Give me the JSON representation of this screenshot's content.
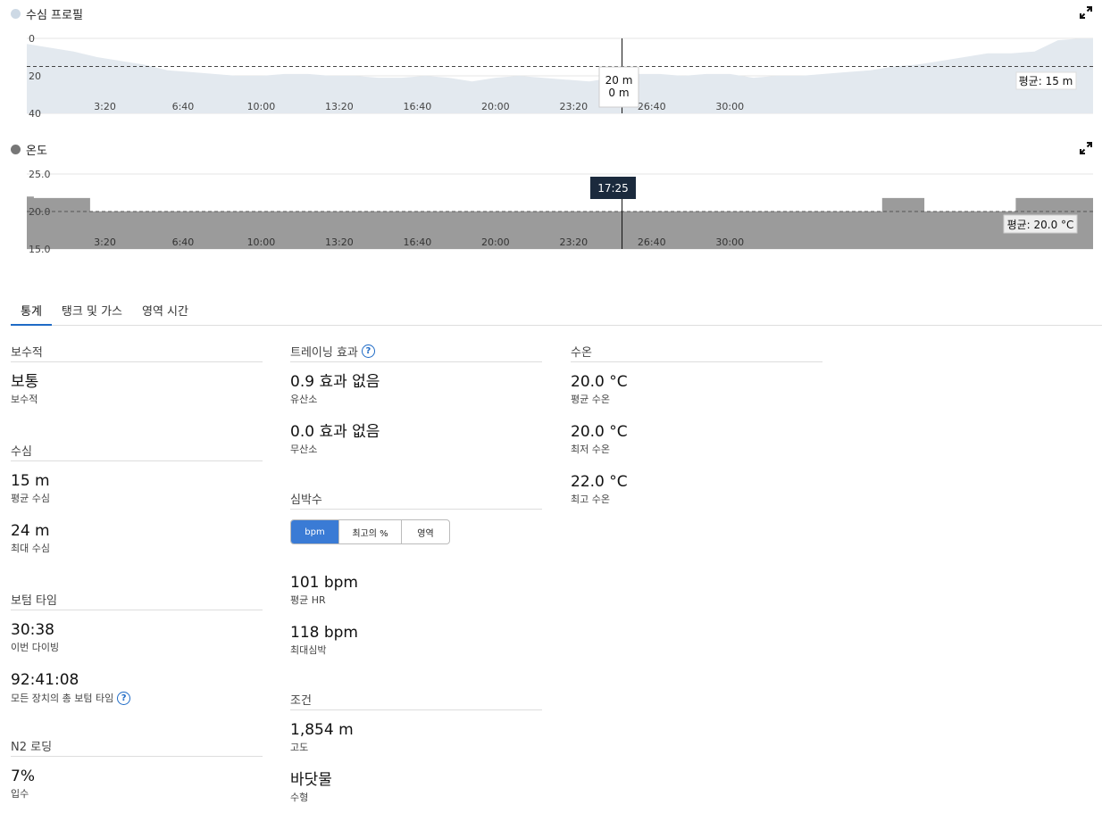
{
  "depth_chart": {
    "title": "수심 프로필",
    "dot_color": "#cdd9e5",
    "fill_color": "#e3e9ef",
    "avg_label": "평균: 15 m",
    "tooltip_line1": "20 m",
    "tooltip_line2": "0 m",
    "y_ticks": [
      "0",
      "20",
      "40"
    ]
  },
  "temp_chart": {
    "title": "온도",
    "dot_color": "#777777",
    "fill_color": "#9b9b9b",
    "avg_label": "평균: 20.0 °C",
    "cursor_time": "17:25",
    "y_ticks": [
      "25.0",
      "20.0",
      "15.0"
    ]
  },
  "x_ticks": [
    "3:20",
    "6:40",
    "10:00",
    "13:20",
    "16:40",
    "20:00",
    "23:20",
    "26:40",
    "30:00"
  ],
  "chart_data": [
    {
      "type": "area",
      "title": "수심 프로필",
      "x_unit": "min",
      "ylim": [
        0,
        40
      ],
      "y_inverted": true,
      "average": 15,
      "cursor_x": 25.4,
      "x": [
        0,
        1,
        2,
        3,
        4,
        5,
        6,
        7,
        8,
        9,
        10,
        11,
        12,
        13,
        14,
        15,
        16,
        17,
        18,
        19,
        20,
        21,
        22,
        23,
        24,
        25,
        26,
        27,
        28,
        29,
        30,
        31,
        32,
        33,
        34,
        35,
        36,
        37,
        38,
        39,
        40,
        41,
        42,
        43,
        44,
        45
      ],
      "y": [
        3,
        5,
        7,
        10,
        12,
        14,
        17,
        18,
        19,
        20,
        20,
        19,
        19,
        20,
        20,
        21,
        21,
        20,
        21,
        23,
        21,
        20,
        21,
        22,
        23,
        21,
        19,
        19,
        20,
        19,
        19,
        21,
        20,
        20,
        19,
        18,
        17,
        15,
        14,
        12,
        10,
        8,
        8,
        7,
        1,
        0
      ]
    },
    {
      "type": "area",
      "title": "온도",
      "x_unit": "min",
      "ylim": [
        15,
        25
      ],
      "average": 20.0,
      "min": 20.0,
      "max": 22.0,
      "cursor_x": 25.4,
      "segments": [
        {
          "x0": 0,
          "x1": 0.3,
          "value": 22.0
        },
        {
          "x0": 0.3,
          "x1": 2.7,
          "value": 21.8
        },
        {
          "x0": 2.7,
          "x1": 36.5,
          "value": 20.0
        },
        {
          "x0": 36.5,
          "x1": 38.3,
          "value": 21.8
        },
        {
          "x0": 38.3,
          "x1": 42.2,
          "value": 20.0
        },
        {
          "x0": 42.2,
          "x1": 44.2,
          "value": 21.8
        }
      ]
    }
  ],
  "tabs": [
    "통계",
    "탱크 및 가스",
    "영역 시간"
  ],
  "stats": {
    "conservatism": {
      "header": "보수적",
      "value": "보통",
      "label": "보수적"
    },
    "depth": {
      "header": "수심",
      "avg_value": "15 m",
      "avg_label": "평균 수심",
      "max_value": "24 m",
      "max_label": "최대 수심"
    },
    "bottom_time": {
      "header": "보텀 타임",
      "dive_value": "30:38",
      "dive_label": "이번 다이빙",
      "total_value": "92:41:08",
      "total_label": "모든 장치의 총 보텀 타임"
    },
    "n2": {
      "header": "N2 로딩",
      "value": "7%",
      "label": "입수"
    },
    "training": {
      "header": "트레이닝 효과",
      "aerobic_value": "0.9 효과 없음",
      "aerobic_label": "유산소",
      "anaerobic_value": "0.0 효과 없음",
      "anaerobic_label": "무산소"
    },
    "hr": {
      "header": "심박수",
      "opt_bpm": "bpm",
      "opt_pct": "최고의 %",
      "opt_zone": "영역",
      "avg_value": "101 bpm",
      "avg_label": "평균 HR",
      "max_value": "118 bpm",
      "max_label": "최대심박"
    },
    "conditions": {
      "header": "조건",
      "altitude_value": "1,854 m",
      "altitude_label": "고도",
      "water_value": "바닷물",
      "water_label": "수형"
    },
    "water_temp": {
      "header": "수온",
      "avg_value": "20.0 °C",
      "avg_label": "평균 수온",
      "min_value": "20.0 °C",
      "min_label": "최저 수온",
      "max_value": "22.0 °C",
      "max_label": "최고 수온"
    }
  },
  "colors": {
    "accent": "#1f6bc6",
    "tooltip_dark": "#1b2a3d"
  }
}
